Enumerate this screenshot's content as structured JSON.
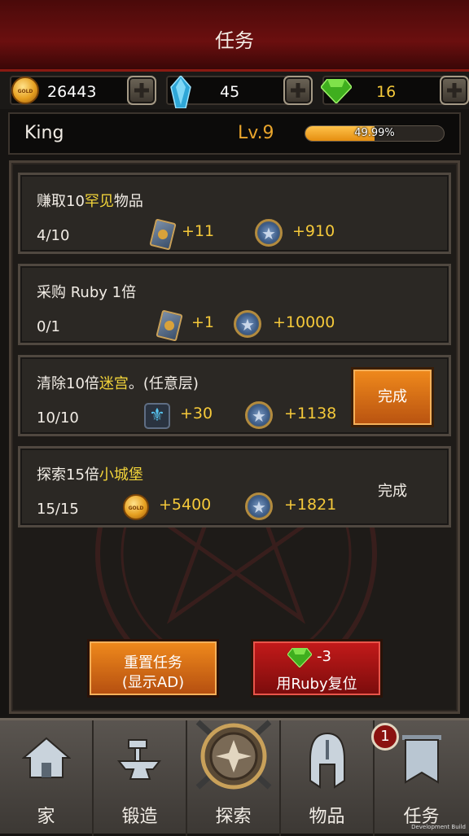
{
  "header": {
    "title": "任务"
  },
  "resources": {
    "gold": {
      "value": "26443",
      "icon": "gold-coin-icon",
      "coin_text": "GOLD"
    },
    "crystal": {
      "value": "45",
      "icon": "crystal-icon"
    },
    "ruby": {
      "value": "16",
      "icon": "emerald-icon"
    }
  },
  "player": {
    "name": "King",
    "level": "Lv.9",
    "xp_text": "49.99%",
    "xp_fraction": 0.4999
  },
  "quests": [
    {
      "title_pre": "赚取10",
      "title_hl": "罕见",
      "title_post": "物品",
      "progress": "4/10",
      "rewards": [
        {
          "icon": "card-icon",
          "value": "+11"
        },
        {
          "icon": "medal-icon",
          "value": "+910"
        }
      ],
      "status": ""
    },
    {
      "title_pre": "采购 Ruby 1倍",
      "title_hl": "",
      "title_post": "",
      "progress": "0/1",
      "rewards": [
        {
          "icon": "card-icon",
          "value": "+1"
        },
        {
          "icon": "medal-icon",
          "value": "+10000"
        }
      ],
      "status": ""
    },
    {
      "title_pre": "清除10倍",
      "title_hl": "迷宫",
      "title_post": "。(任意层)",
      "progress": "10/10",
      "rewards": [
        {
          "icon": "fleur-icon",
          "value": "+30"
        },
        {
          "icon": "medal-icon",
          "value": "+1138"
        }
      ],
      "status": "完成"
    },
    {
      "title_pre": "探索15倍",
      "title_hl": "小城堡",
      "title_post": "",
      "progress": "15/15",
      "rewards": [
        {
          "icon": "gold-coin-icon",
          "value": "+5400"
        },
        {
          "icon": "medal-icon",
          "value": "+1821"
        }
      ],
      "status": "完成"
    }
  ],
  "actions": {
    "reset_line1": "重置任务",
    "reset_line2": "(显示AD)",
    "ruby_cost": "-3",
    "ruby_reset": "用Ruby复位"
  },
  "nav": {
    "home": "家",
    "forge": "锻造",
    "explore": "探索",
    "items": "物品",
    "quests": "任务",
    "quests_badge": "1"
  },
  "footer": {
    "dev_build": "Development Build"
  },
  "colors": {
    "accent_orange": "#e9a52c",
    "highlight_yellow": "#f2d43a",
    "reward_yellow": "#f5c93a",
    "header_red": "#6b0f0f"
  }
}
